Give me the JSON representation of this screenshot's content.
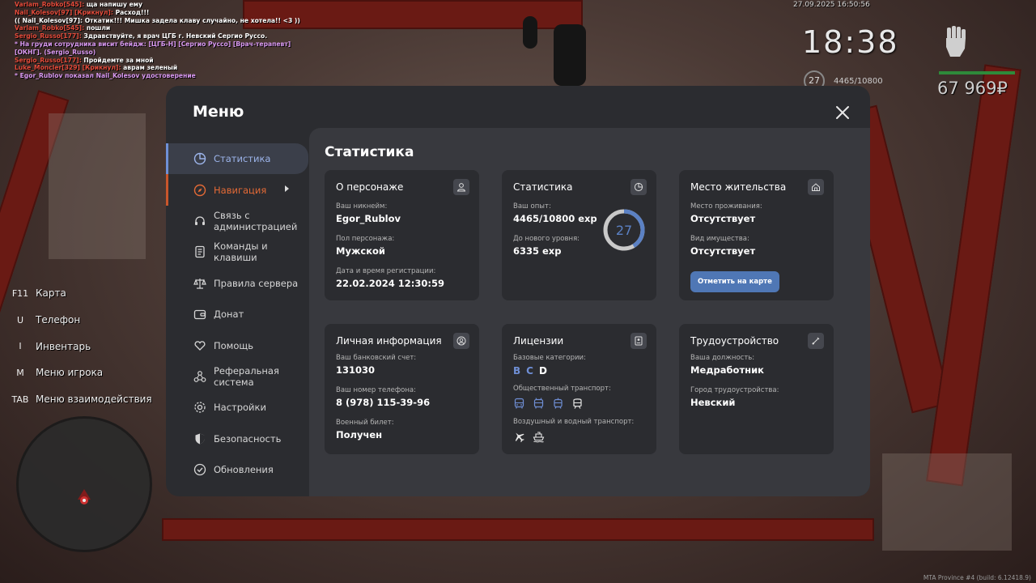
{
  "chat": [
    {
      "name": "Varlam_Robko[545]:",
      "name_class": "name-red",
      "text": "ща напишу ему",
      "text_class": "t-white"
    },
    {
      "name": "Nail_Kolesov[97] [Крикнул]:",
      "name_class": "name-red",
      "text": "Расход!!!",
      "text_class": "t-white"
    },
    {
      "name": "((",
      "name_class": "t-white",
      "text": "Nail_Kolesov[97]: Откатик!!! Мишка задела клаву случайно, не хотела!! <3 ))",
      "text_class": "t-white"
    },
    {
      "name": "Varlam_Robko[545]:",
      "name_class": "name-red",
      "text": "пошли",
      "text_class": "t-white"
    },
    {
      "name": "Sergio_Russo[177]:",
      "name_class": "name-red",
      "text": "Здравствуйте, я врач ЦГБ г. Невский Сергио Руссо.",
      "text_class": "t-white"
    },
    {
      "name": "",
      "name_class": "t-pink",
      "text": "* На груди сотрудника висит бейдж: [ЦГБ-Н] [Сергио Руссо] [Врач-терапевт]",
      "text_class": "t-pink"
    },
    {
      "name": "",
      "name_class": "t-pink",
      "text": "[ОКНГ]. (Sergio_Russo)",
      "text_class": "t-pink"
    },
    {
      "name": "Sergio_Russo[177]:",
      "name_class": "name-red",
      "text": "Пройдемте за мной",
      "text_class": "t-white"
    },
    {
      "name": "Luke_Moncler[329] [Крикнул]:",
      "name_class": "name-red",
      "text": "аврам зеленый",
      "text_class": "t-white"
    },
    {
      "name": "",
      "name_class": "t-pink",
      "text": "* Egor_Rublov показал Nail_Kolesov удостоверение",
      "text_class": "t-pink"
    }
  ],
  "hud": {
    "date": "27.09.2025 16:50:56",
    "time": "18:38",
    "level": "27",
    "exp": "4465/10800",
    "money": "67 969₽"
  },
  "hotkeys": [
    {
      "key": "F11",
      "label": "Карта"
    },
    {
      "key": "U",
      "label": "Телефон"
    },
    {
      "key": "I",
      "label": "Инвентарь"
    },
    {
      "key": "M",
      "label": "Меню игрока"
    },
    {
      "key": "TAB",
      "label": "Меню взаимодействия"
    }
  ],
  "watermark": "MTA Province #4 (build: 6.12418.9)",
  "menu": {
    "title": "Меню",
    "sidebar": [
      {
        "label": "Статистика",
        "icon": "pie-chart-icon"
      },
      {
        "label": "Навигация",
        "icon": "compass-icon"
      },
      {
        "label": "Связь с администрацией",
        "icon": "headset-icon"
      },
      {
        "label": "Команды и клавиши",
        "icon": "document-icon"
      },
      {
        "label": "Правила сервера",
        "icon": "scales-icon"
      },
      {
        "label": "Донат",
        "icon": "wallet-icon"
      },
      {
        "label": "Помощь",
        "icon": "heart-hand-icon"
      },
      {
        "label": "Реферальная система",
        "icon": "network-icon"
      },
      {
        "label": "Настройки",
        "icon": "gear-icon"
      },
      {
        "label": "Безопасность",
        "icon": "shield-icon"
      },
      {
        "label": "Обновления",
        "icon": "check-circle-icon"
      }
    ],
    "content_title": "Статистика",
    "about": {
      "title": "О персонаже",
      "nick_label": "Ваш никнейм:",
      "nick": "Egor_Rublov",
      "gender_label": "Пол персонажа:",
      "gender": "Мужской",
      "reg_label": "Дата и время регистрации:",
      "reg": "22.02.2024 12:30:59"
    },
    "stats": {
      "title": "Статистика",
      "exp_label": "Ваш опыт:",
      "exp": "4465/10800 exp",
      "next_label": "До нового уровня:",
      "next": "6335 exp",
      "level": "27",
      "progress": 0.4134
    },
    "residence": {
      "title": "Место жительства",
      "place_label": "Место проживания:",
      "place": "Отсутствует",
      "property_label": "Вид имущества:",
      "property": "Отсутствует",
      "button": "Отметить на карте"
    },
    "personal": {
      "title": "Личная информация",
      "bank_label": "Ваш банковский счет:",
      "bank": "131030",
      "phone_label": "Ваш номер телефона:",
      "phone": "8 (978) 115-39-96",
      "military_label": "Военный билет:",
      "military": "Получен"
    },
    "licenses": {
      "title": "Лицензии",
      "base_label": "Базовые категории:",
      "cats": [
        "B",
        "C",
        "D"
      ],
      "public_label": "Общественный транспорт:",
      "air_label": "Воздушный и водный транспорт:"
    },
    "employment": {
      "title": "Трудоустройство",
      "position_label": "Ваша должность:",
      "position": "Медработник",
      "city_label": "Город трудоустройства:",
      "city": "Невский"
    }
  },
  "colors": {
    "accent": "#6f8fd6",
    "nav_accent": "#e46a36",
    "button": "#4f77b5",
    "money_bar": "#2e8a3a"
  }
}
